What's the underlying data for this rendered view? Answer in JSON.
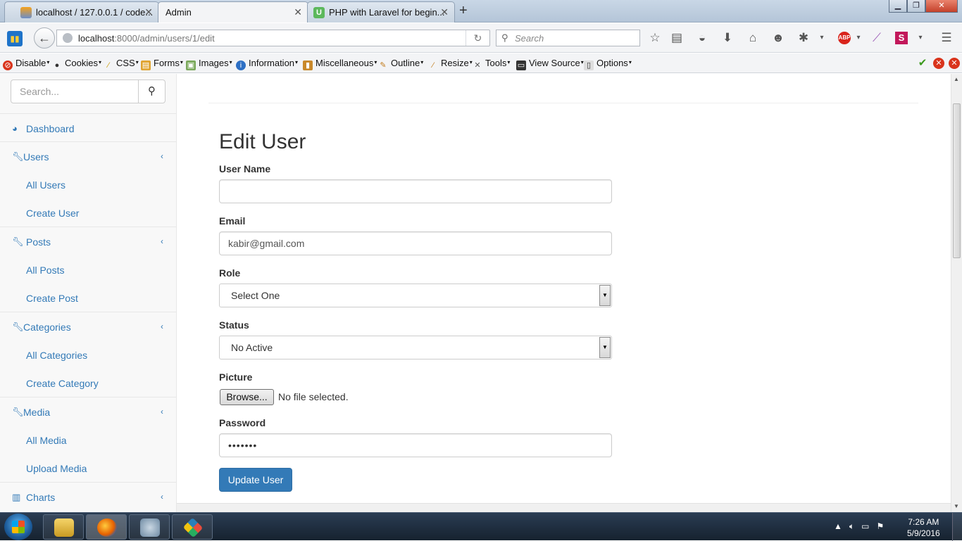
{
  "browser": {
    "tabs": [
      {
        "title": "localhost / 127.0.0.1 / code..."
      },
      {
        "title": "Admin"
      },
      {
        "title": "PHP with Laravel for begin..."
      }
    ],
    "url_host": "localhost",
    "url_path": ":8000/admin/users/1/edit",
    "search_placeholder": "Search"
  },
  "devtoolbar": {
    "items": [
      "Disable",
      "Cookies",
      "CSS",
      "Forms",
      "Images",
      "Information",
      "Miscellaneous",
      "Outline",
      "Resize",
      "Tools",
      "View Source",
      "Options"
    ]
  },
  "sidebar": {
    "search_placeholder": "Search...",
    "dashboard": "Dashboard",
    "sections": [
      {
        "label": "Users",
        "items": [
          "All Users",
          "Create User"
        ]
      },
      {
        "label": "Posts",
        "items": [
          "All Posts",
          "Create Post"
        ]
      },
      {
        "label": "Categories",
        "items": [
          "All Categories",
          "Create Category"
        ]
      },
      {
        "label": "Media",
        "items": [
          "All Media",
          "Upload Media"
        ]
      },
      {
        "label": "Charts",
        "items": []
      }
    ]
  },
  "form": {
    "title": "Edit User",
    "name_label": "User Name",
    "name_value": "",
    "email_label": "Email",
    "email_value": "kabir@gmail.com",
    "role_label": "Role",
    "role_value": "Select One",
    "status_label": "Status",
    "status_value": "No Active",
    "picture_label": "Picture",
    "browse_label": "Browse...",
    "file_status": "No file selected.",
    "password_label": "Password",
    "password_value": "•••••••",
    "submit_label": "Update User"
  },
  "taskbar": {
    "time": "7:26 AM",
    "date": "5/9/2016"
  }
}
